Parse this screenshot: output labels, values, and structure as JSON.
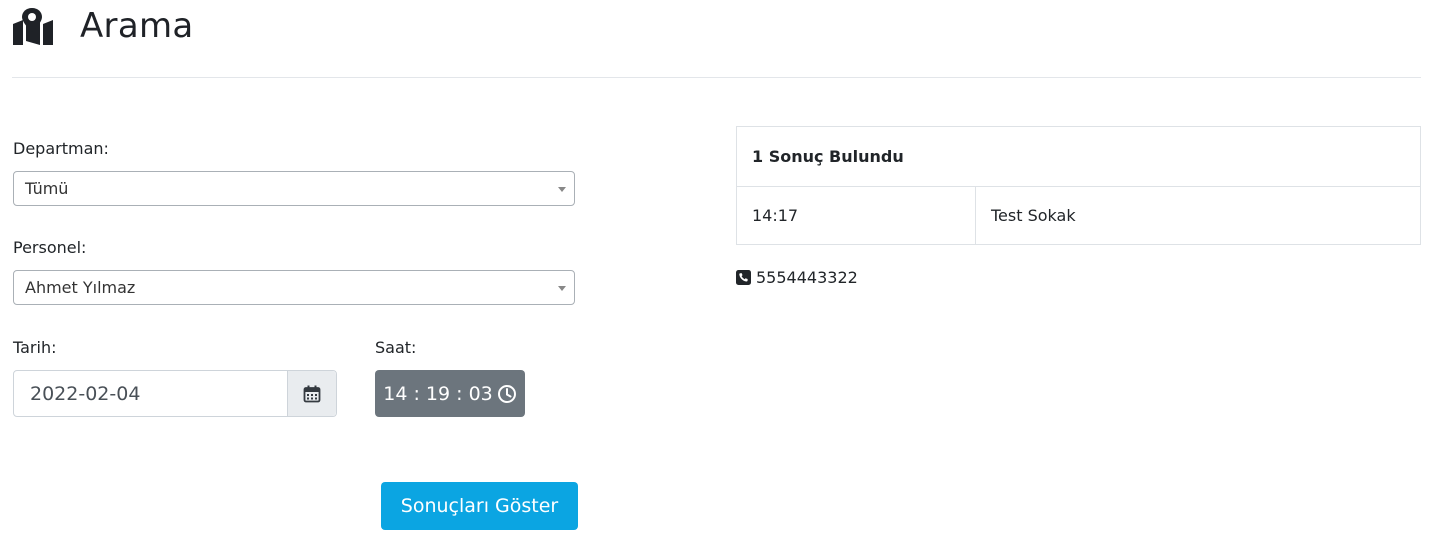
{
  "page": {
    "title": "Arama"
  },
  "form": {
    "department_label": "Departman:",
    "department_value": "Tümü",
    "personnel_label": "Personel:",
    "personnel_value": "Ahmet Yılmaz",
    "date_label": "Tarih:",
    "date_value": "2022-02-04",
    "time_label": "Saat:",
    "time_value": "14 : 19 : 03",
    "submit_label": "Sonuçları Göster"
  },
  "results": {
    "summary": "1 Sonuç Bulundu",
    "rows": [
      {
        "time": "14:17",
        "address": "Test Sokak"
      }
    ],
    "phone": "5554443322"
  },
  "icons": {
    "header": "map-marker-icon",
    "calendar": "calendar-icon",
    "clock": "clock-icon",
    "phone": "phone-square-icon"
  },
  "colors": {
    "primary_button": "#0ba5e2",
    "secondary_button": "#6c757d"
  }
}
